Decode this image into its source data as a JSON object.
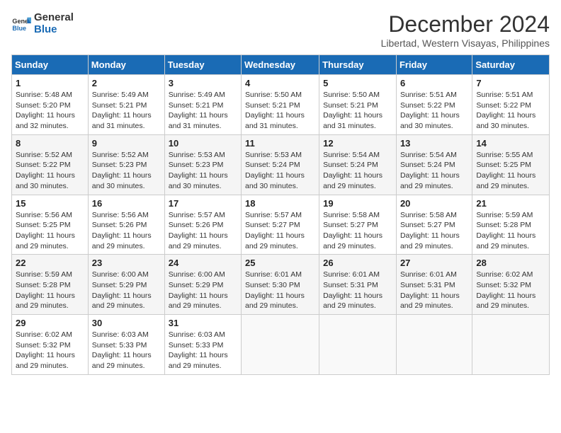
{
  "logo": {
    "line1": "General",
    "line2": "Blue"
  },
  "title": "December 2024",
  "location": "Libertad, Western Visayas, Philippines",
  "headers": [
    "Sunday",
    "Monday",
    "Tuesday",
    "Wednesday",
    "Thursday",
    "Friday",
    "Saturday"
  ],
  "weeks": [
    [
      {
        "day": "1",
        "sunrise": "5:48 AM",
        "sunset": "5:20 PM",
        "daylight": "11 hours and 32 minutes."
      },
      {
        "day": "2",
        "sunrise": "5:49 AM",
        "sunset": "5:21 PM",
        "daylight": "11 hours and 31 minutes."
      },
      {
        "day": "3",
        "sunrise": "5:49 AM",
        "sunset": "5:21 PM",
        "daylight": "11 hours and 31 minutes."
      },
      {
        "day": "4",
        "sunrise": "5:50 AM",
        "sunset": "5:21 PM",
        "daylight": "11 hours and 31 minutes."
      },
      {
        "day": "5",
        "sunrise": "5:50 AM",
        "sunset": "5:21 PM",
        "daylight": "11 hours and 31 minutes."
      },
      {
        "day": "6",
        "sunrise": "5:51 AM",
        "sunset": "5:22 PM",
        "daylight": "11 hours and 30 minutes."
      },
      {
        "day": "7",
        "sunrise": "5:51 AM",
        "sunset": "5:22 PM",
        "daylight": "11 hours and 30 minutes."
      }
    ],
    [
      {
        "day": "8",
        "sunrise": "5:52 AM",
        "sunset": "5:22 PM",
        "daylight": "11 hours and 30 minutes."
      },
      {
        "day": "9",
        "sunrise": "5:52 AM",
        "sunset": "5:23 PM",
        "daylight": "11 hours and 30 minutes."
      },
      {
        "day": "10",
        "sunrise": "5:53 AM",
        "sunset": "5:23 PM",
        "daylight": "11 hours and 30 minutes."
      },
      {
        "day": "11",
        "sunrise": "5:53 AM",
        "sunset": "5:24 PM",
        "daylight": "11 hours and 30 minutes."
      },
      {
        "day": "12",
        "sunrise": "5:54 AM",
        "sunset": "5:24 PM",
        "daylight": "11 hours and 29 minutes."
      },
      {
        "day": "13",
        "sunrise": "5:54 AM",
        "sunset": "5:24 PM",
        "daylight": "11 hours and 29 minutes."
      },
      {
        "day": "14",
        "sunrise": "5:55 AM",
        "sunset": "5:25 PM",
        "daylight": "11 hours and 29 minutes."
      }
    ],
    [
      {
        "day": "15",
        "sunrise": "5:56 AM",
        "sunset": "5:25 PM",
        "daylight": "11 hours and 29 minutes."
      },
      {
        "day": "16",
        "sunrise": "5:56 AM",
        "sunset": "5:26 PM",
        "daylight": "11 hours and 29 minutes."
      },
      {
        "day": "17",
        "sunrise": "5:57 AM",
        "sunset": "5:26 PM",
        "daylight": "11 hours and 29 minutes."
      },
      {
        "day": "18",
        "sunrise": "5:57 AM",
        "sunset": "5:27 PM",
        "daylight": "11 hours and 29 minutes."
      },
      {
        "day": "19",
        "sunrise": "5:58 AM",
        "sunset": "5:27 PM",
        "daylight": "11 hours and 29 minutes."
      },
      {
        "day": "20",
        "sunrise": "5:58 AM",
        "sunset": "5:27 PM",
        "daylight": "11 hours and 29 minutes."
      },
      {
        "day": "21",
        "sunrise": "5:59 AM",
        "sunset": "5:28 PM",
        "daylight": "11 hours and 29 minutes."
      }
    ],
    [
      {
        "day": "22",
        "sunrise": "5:59 AM",
        "sunset": "5:28 PM",
        "daylight": "11 hours and 29 minutes."
      },
      {
        "day": "23",
        "sunrise": "6:00 AM",
        "sunset": "5:29 PM",
        "daylight": "11 hours and 29 minutes."
      },
      {
        "day": "24",
        "sunrise": "6:00 AM",
        "sunset": "5:29 PM",
        "daylight": "11 hours and 29 minutes."
      },
      {
        "day": "25",
        "sunrise": "6:01 AM",
        "sunset": "5:30 PM",
        "daylight": "11 hours and 29 minutes."
      },
      {
        "day": "26",
        "sunrise": "6:01 AM",
        "sunset": "5:31 PM",
        "daylight": "11 hours and 29 minutes."
      },
      {
        "day": "27",
        "sunrise": "6:01 AM",
        "sunset": "5:31 PM",
        "daylight": "11 hours and 29 minutes."
      },
      {
        "day": "28",
        "sunrise": "6:02 AM",
        "sunset": "5:32 PM",
        "daylight": "11 hours and 29 minutes."
      }
    ],
    [
      {
        "day": "29",
        "sunrise": "6:02 AM",
        "sunset": "5:32 PM",
        "daylight": "11 hours and 29 minutes."
      },
      {
        "day": "30",
        "sunrise": "6:03 AM",
        "sunset": "5:33 PM",
        "daylight": "11 hours and 29 minutes."
      },
      {
        "day": "31",
        "sunrise": "6:03 AM",
        "sunset": "5:33 PM",
        "daylight": "11 hours and 29 minutes."
      },
      null,
      null,
      null,
      null
    ]
  ],
  "labels": {
    "sunrise": "Sunrise:",
    "sunset": "Sunset:",
    "daylight": "Daylight:"
  }
}
